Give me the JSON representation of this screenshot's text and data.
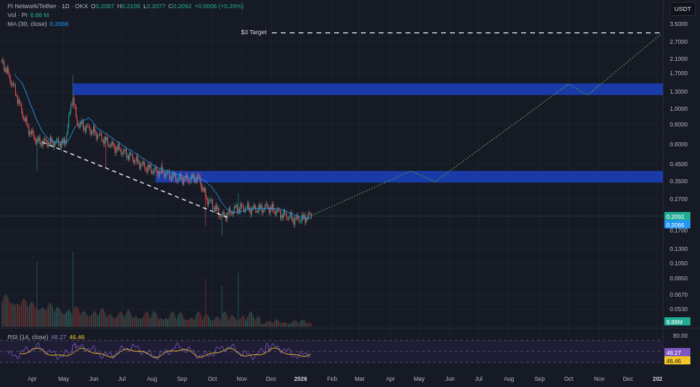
{
  "legend": {
    "title": "Pi Network/Tether · 1D · OKX",
    "ohlc": [
      {
        "label": "O",
        "value": "0.2087"
      },
      {
        "label": "H",
        "value": "0.2105"
      },
      {
        "label": "L",
        "value": "0.2077"
      },
      {
        "label": "C",
        "value": "0.2092"
      }
    ],
    "change": "+0.0006 (+0.29%)",
    "volume": {
      "label": "Vol · PI",
      "value": "8.88 M"
    },
    "moving_average": {
      "label": "MA (30, close)",
      "value": "0.2066"
    }
  },
  "currency_button": "USDT",
  "annotation": "$3 Target",
  "price_axis": {
    "labels": [
      "3.5000",
      "2.7000",
      "2.1000",
      "1.7000",
      "1.3000",
      "1.0000",
      "0.8000",
      "0.6000",
      "0.4500",
      "0.3500",
      "0.2700",
      "0.1700",
      "0.1300",
      "0.1050",
      "0.0850",
      "0.0670",
      "0.0530"
    ],
    "badges": [
      {
        "text": "0.2092",
        "color": "#22ab94"
      },
      {
        "text": "0.2066",
        "color": "#2196f3"
      },
      {
        "text": "8.88M",
        "color": "#22ab94"
      }
    ]
  },
  "rsi": {
    "label": "RSI (14, close)",
    "value": "48.27",
    "signal": "46.46",
    "axis_label": "80.00",
    "badges": [
      {
        "text": "48.27",
        "color": "#7e57c2"
      },
      {
        "text": "46.46",
        "color": "#f2c624"
      }
    ]
  },
  "time_axis": [
    {
      "label": "Apr",
      "kind": "month"
    },
    {
      "label": "May",
      "kind": "month"
    },
    {
      "label": "Jun",
      "kind": "month"
    },
    {
      "label": "Jul",
      "kind": "month"
    },
    {
      "label": "Aug",
      "kind": "month"
    },
    {
      "label": "Sep",
      "kind": "month"
    },
    {
      "label": "Oct",
      "kind": "month"
    },
    {
      "label": "Nov",
      "kind": "month"
    },
    {
      "label": "Dec",
      "kind": "month"
    },
    {
      "label": "2026",
      "kind": "year"
    },
    {
      "label": "Feb",
      "kind": "month"
    },
    {
      "label": "Mar",
      "kind": "month"
    },
    {
      "label": "Apr",
      "kind": "month"
    },
    {
      "label": "May",
      "kind": "month"
    },
    {
      "label": "Jun",
      "kind": "month"
    },
    {
      "label": "Jul",
      "kind": "month"
    },
    {
      "label": "Aug",
      "kind": "month"
    },
    {
      "label": "Sep",
      "kind": "month"
    },
    {
      "label": "Oct",
      "kind": "month"
    },
    {
      "label": "Nov",
      "kind": "month"
    },
    {
      "label": "Dec",
      "kind": "month"
    },
    {
      "label": "202",
      "kind": "year"
    }
  ]
}
